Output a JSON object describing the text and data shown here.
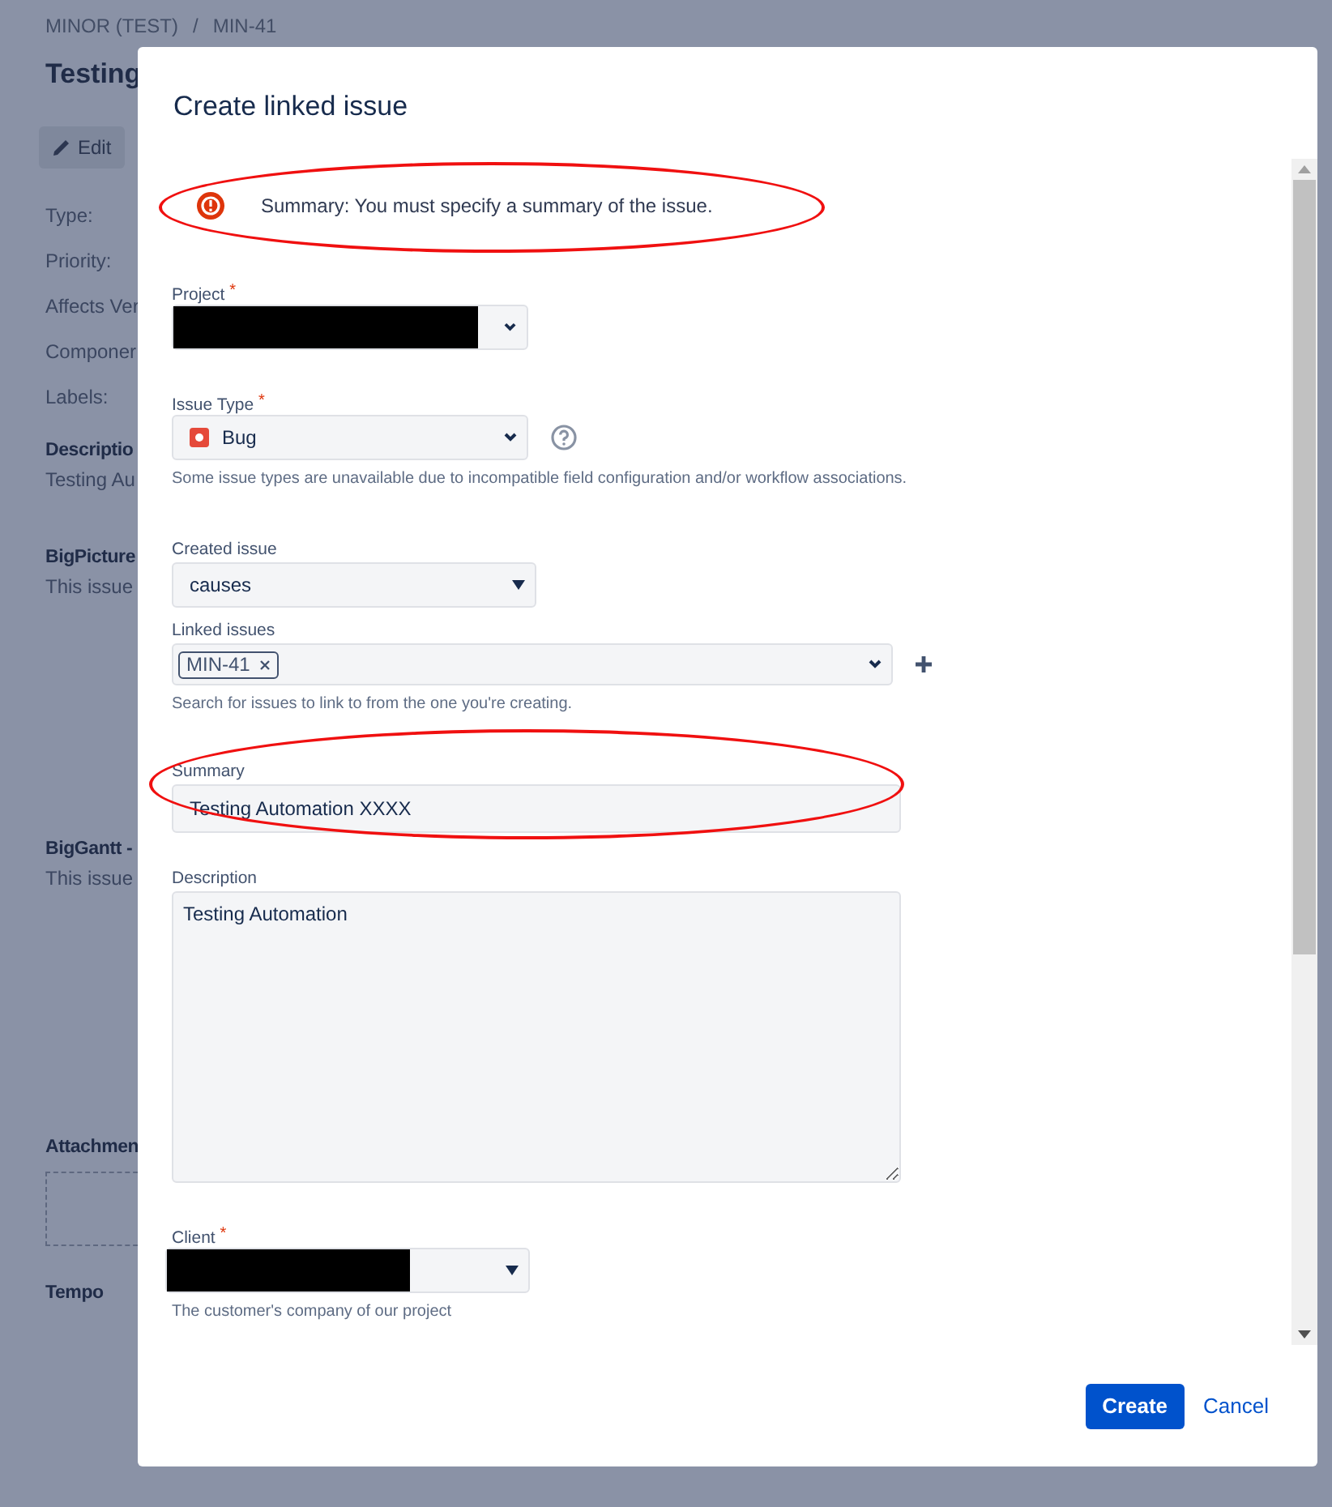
{
  "page": {
    "breadcrumb": [
      {
        "text": "MINOR (TEST)"
      },
      {
        "text": "/"
      },
      {
        "text": "MIN-41"
      }
    ],
    "title": "Testing",
    "edit_button": "Edit",
    "fields": [
      "Type:",
      "Priority:",
      "Affects Ver",
      "Componer",
      "Labels:"
    ],
    "sections": [
      {
        "heading": "Descriptio",
        "text": "Testing Au"
      },
      {
        "heading": "BigPicture",
        "text": "This issue"
      },
      {
        "heading": "BigGantt -",
        "text": "This issue"
      },
      {
        "heading": "Attachmen",
        "kind": "dropzone"
      },
      {
        "heading": "Tempo"
      }
    ]
  },
  "dialog": {
    "title": "Create linked issue",
    "error": {
      "message": "Summary: You must specify a summary of the issue.",
      "circled": true
    },
    "fields": [
      {
        "kind": "select",
        "label": "Project",
        "required_mark": "*",
        "redacted": true
      },
      {
        "kind": "issue-type-select",
        "label": "Issue Type",
        "required_mark": "*",
        "value": "Bug",
        "help_icon": true,
        "help": "Some issue types are unavailable due to incompatible field configuration and/or workflow associations."
      },
      {
        "kind": "native-select",
        "label": "Created issue",
        "value": "causes"
      },
      {
        "kind": "multi",
        "label": "Linked issues",
        "tags": [
          "MIN-41"
        ],
        "add_button": true,
        "help": "Search for issues to link to from the one you're creating."
      },
      {
        "kind": "text",
        "label": "Summary",
        "value": "Testing Automation XXXX",
        "circled": true
      },
      {
        "kind": "textarea",
        "label": "Description",
        "value": "Testing Automation"
      },
      {
        "kind": "native-select",
        "label": "Client",
        "required_mark": "*",
        "redacted": true,
        "help": "The customer's company of our project"
      }
    ],
    "buttons": {
      "create": "Create",
      "cancel": "Cancel"
    }
  }
}
